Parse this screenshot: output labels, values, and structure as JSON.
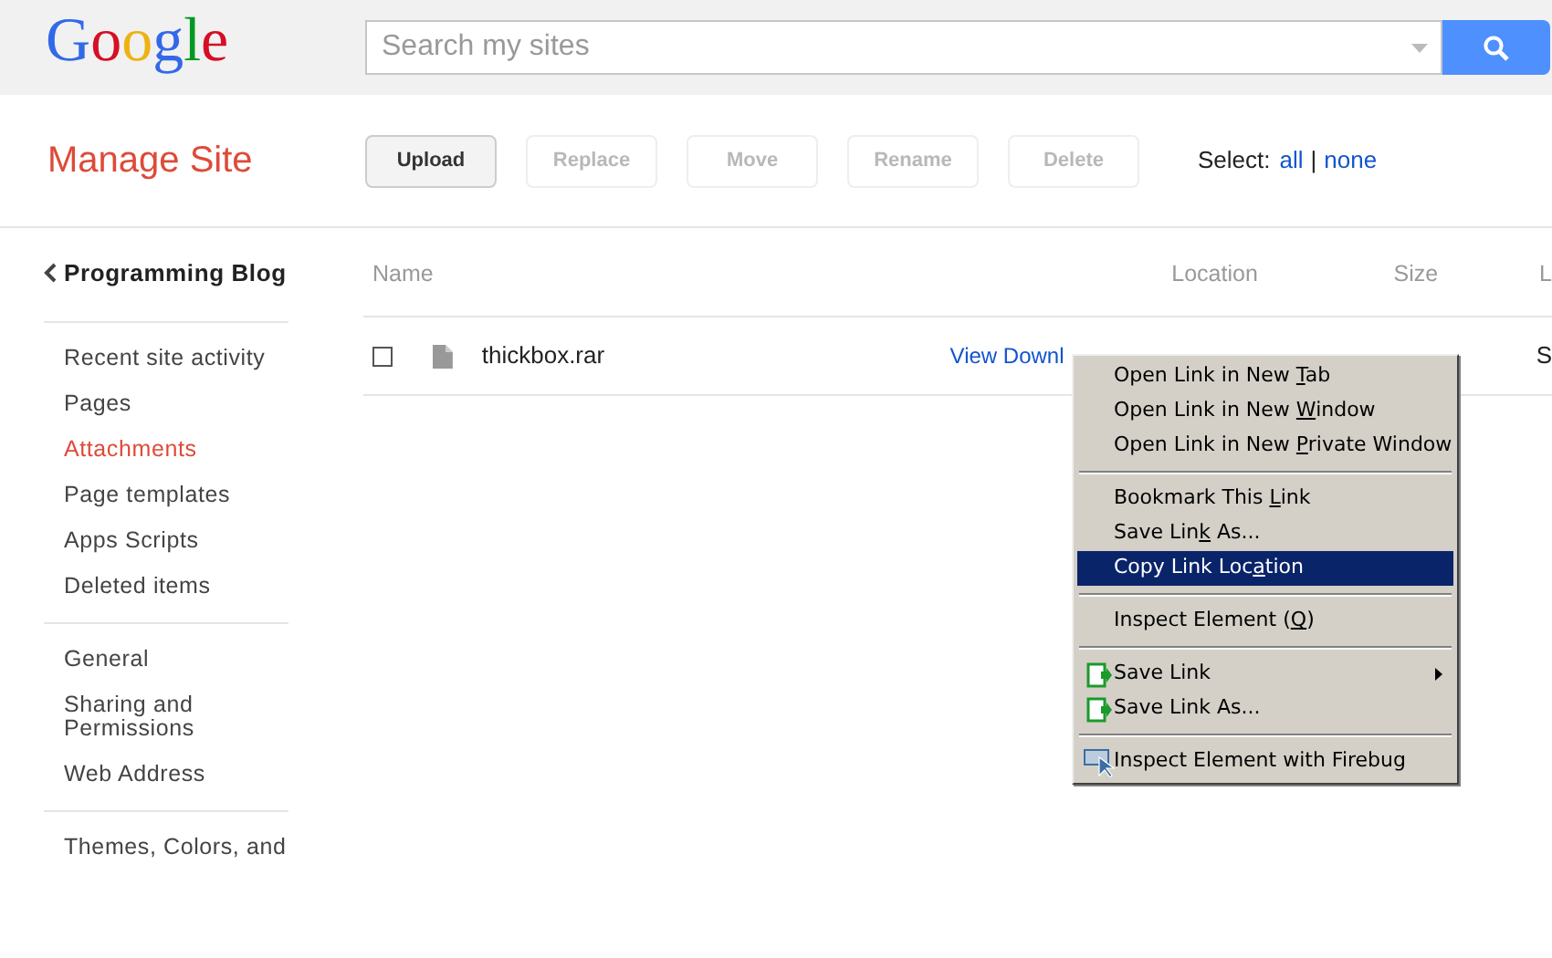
{
  "header": {
    "logo": "Google",
    "search": {
      "placeholder": "Search my sites"
    }
  },
  "toolbar": {
    "title": "Manage Site",
    "buttons": [
      {
        "label": "Upload",
        "disabled": false
      },
      {
        "label": "Replace",
        "disabled": true
      },
      {
        "label": "Move",
        "disabled": true
      },
      {
        "label": "Rename",
        "disabled": true
      },
      {
        "label": "Delete",
        "disabled": true
      }
    ],
    "select_label": "Select:",
    "select_links": [
      "all",
      "none"
    ],
    "separator": "|"
  },
  "sidebar": {
    "site": "Programming Blog",
    "groups": [
      [
        {
          "label": "Recent site activity",
          "selected": false
        },
        {
          "label": "Pages",
          "selected": false
        },
        {
          "label": "Attachments",
          "selected": true
        },
        {
          "label": "Page templates",
          "selected": false
        },
        {
          "label": "Apps Scripts",
          "selected": false
        },
        {
          "label": "Deleted items",
          "selected": false
        }
      ],
      [
        {
          "label": "General",
          "selected": false
        },
        {
          "label": "Sharing and Permissions",
          "selected": false
        },
        {
          "label": "Web Address",
          "selected": false
        }
      ],
      [
        {
          "label": "Themes, Colors, and",
          "selected": false
        }
      ]
    ]
  },
  "table": {
    "columns": [
      "Name",
      "Location",
      "Size",
      "L"
    ],
    "rows": [
      {
        "checked": false,
        "name": "thickbox.rar",
        "link": "View Downl",
        "column_4": "S"
      }
    ]
  },
  "context_menu": {
    "groups": [
      [
        {
          "kind": "plain",
          "parts": [
            "Open Link in New ",
            "T",
            "ab"
          ],
          "selected": false
        },
        {
          "kind": "plain",
          "parts": [
            "Open Link in New ",
            "W",
            "indow"
          ],
          "selected": false
        },
        {
          "kind": "plain",
          "parts": [
            "Open Link in New ",
            "P",
            "rivate Window"
          ],
          "selected": false
        }
      ],
      [
        {
          "kind": "plain",
          "parts": [
            "Bookmark This ",
            "L",
            "ink"
          ],
          "selected": false
        },
        {
          "kind": "plain",
          "parts": [
            "Save Lin",
            "k",
            " As..."
          ],
          "selected": false
        },
        {
          "kind": "plain",
          "parts": [
            "Copy Link Loc",
            "a",
            "tion"
          ],
          "selected": true
        }
      ],
      [
        {
          "kind": "plain",
          "parts": [
            "Inspect Element (",
            "Q",
            ")"
          ],
          "selected": false
        }
      ],
      [
        {
          "kind": "save",
          "parts": [
            "Save Link"
          ],
          "submenu": true,
          "selected": false
        },
        {
          "kind": "save",
          "parts": [
            "Save Link As..."
          ],
          "submenu": false,
          "selected": false
        }
      ],
      [
        {
          "kind": "firebug",
          "parts": [
            "Inspect Element with Firebug"
          ],
          "selected": false
        }
      ]
    ]
  }
}
